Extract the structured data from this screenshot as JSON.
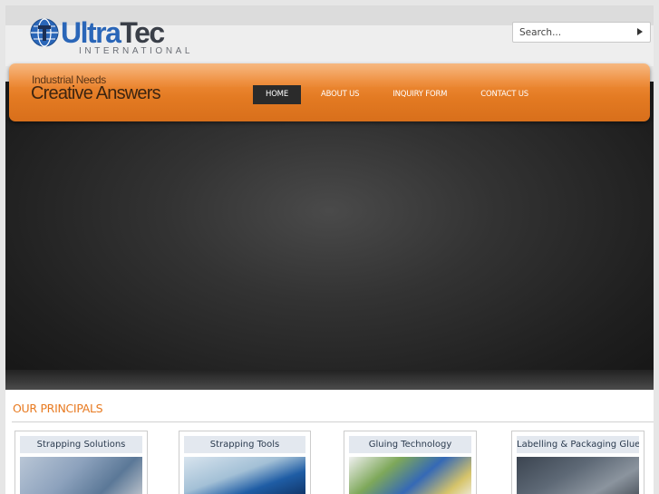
{
  "logo": {
    "name_part1": "Ultra",
    "name_part2": "Tec",
    "subtitle": "INTERNATIONAL"
  },
  "search": {
    "placeholder": "Search..."
  },
  "tagline": {
    "line1": "Industrial Needs",
    "line2": "Creative Answers"
  },
  "nav": {
    "items": [
      {
        "label": "HOME",
        "active": true
      },
      {
        "label": "ABOUT US",
        "active": false
      },
      {
        "label": "INQUIRY FORM",
        "active": false
      },
      {
        "label": "CONTACT US",
        "active": false
      }
    ]
  },
  "principals": {
    "title": "OUR PRINCIPALS",
    "cards": [
      {
        "label": "Strapping Solutions"
      },
      {
        "label": "Strapping Tools"
      },
      {
        "label": "Gluing Technology"
      },
      {
        "label": "Labelling & Packaging Glues"
      }
    ]
  },
  "colors": {
    "accent_orange": "#e37a22",
    "logo_blue": "#2a66b8",
    "nav_active_bg": "#2b2b2b"
  }
}
